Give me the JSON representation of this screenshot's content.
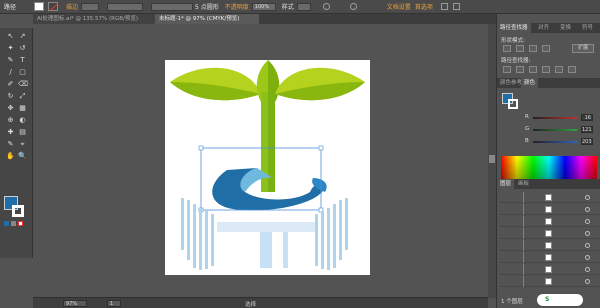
{
  "control_bar": {
    "title": "路径",
    "stroke_label": "描边",
    "fill_color": "#ffffff",
    "profile_label": "5 点圆形",
    "opacity_label": "不透明度",
    "opacity_value": "100%",
    "style_label": "样式",
    "doc_setup_label": "文档设置",
    "prefs_label": "首选项"
  },
  "tabs": [
    {
      "label": "AI处理图标.ai* @ 135.57% (RGB/预览)",
      "active": false
    },
    {
      "label": "未标题-1* @ 97% (CMYK/预览)",
      "active": true
    }
  ],
  "tools": [
    "↖",
    "↗",
    "✦",
    "↺",
    "✎",
    "T",
    "/",
    "▢",
    "✐",
    "⌫",
    "↻",
    "⤢",
    "✥",
    "▦",
    "⊕",
    "◐",
    "✚",
    "▤",
    "✎",
    "⌖",
    "✋",
    "🔍"
  ],
  "status": {
    "zoom": "97%",
    "page": "1",
    "tool_name": "选择"
  },
  "panels": {
    "top_tabs": [
      "路径查找器",
      "对齐",
      "变换",
      "符号"
    ],
    "shape_modes_label": "形状模式:",
    "expand_label": "扩展",
    "pathfinder_label": "路径查找器:",
    "color_tabs": [
      "颜色参考",
      "颜色"
    ],
    "color_rows": [
      {
        "label": "R",
        "value": "16",
        "color": "#c03030"
      },
      {
        "label": "G",
        "value": "121",
        "color": "#30a040"
      },
      {
        "label": "B",
        "value": "203",
        "color": "#3060c0"
      }
    ],
    "layer_tabs": [
      "图层",
      "画板"
    ],
    "layers_count": 8,
    "layers_footer": "1 个图层"
  },
  "colors": {
    "leaf_light": "#b5d21e",
    "leaf_dark": "#8ab70f",
    "stem": "#8bc21a",
    "ring": "#1f6fa6",
    "ring_light": "#6fb8e0",
    "base_blue": "#aed3ee",
    "fill_swatch": "#1e6ea8"
  }
}
